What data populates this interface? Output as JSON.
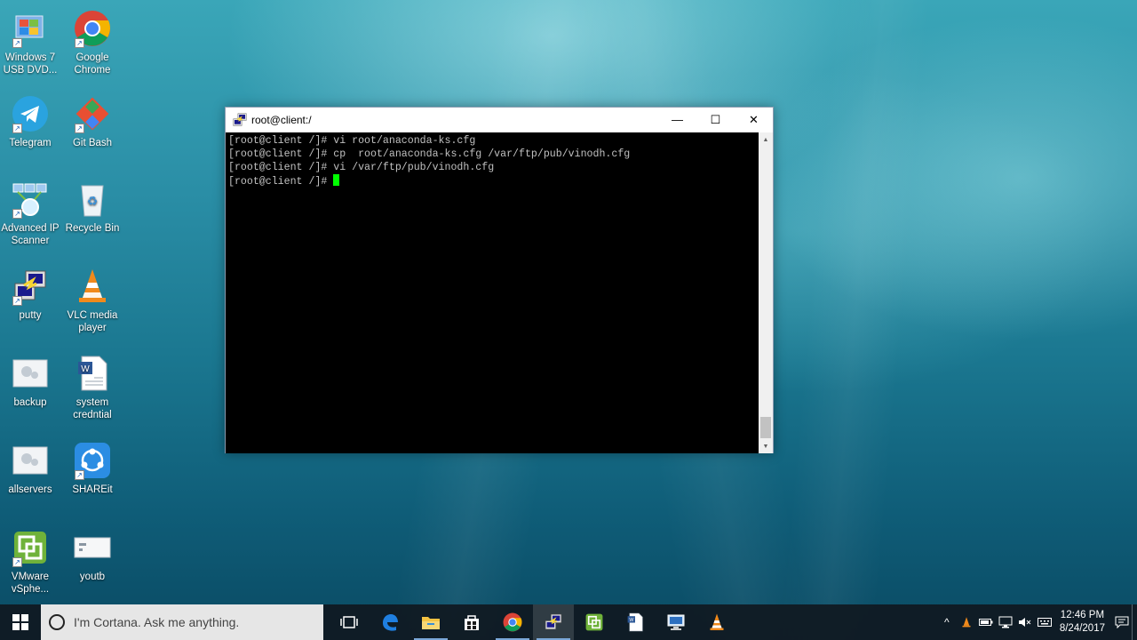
{
  "desktop": {
    "icons": [
      {
        "label": "Windows 7 USB DVD...",
        "icon": "usb-dvd-tool-icon"
      },
      {
        "label": "Google Chrome",
        "icon": "chrome-icon"
      },
      {
        "label": "Telegram",
        "icon": "telegram-icon"
      },
      {
        "label": "Git Bash",
        "icon": "git-bash-icon"
      },
      {
        "label": "Advanced IP Scanner",
        "icon": "ip-scanner-icon"
      },
      {
        "label": "Recycle Bin",
        "icon": "recycle-bin-icon"
      },
      {
        "label": "putty",
        "icon": "putty-icon"
      },
      {
        "label": "VLC media player",
        "icon": "vlc-icon"
      },
      {
        "label": "backup",
        "icon": "shortcut-file-icon"
      },
      {
        "label": "system credntial",
        "icon": "word-document-icon"
      },
      {
        "label": "allservers",
        "icon": "shortcut-file-icon"
      },
      {
        "label": "SHAREit",
        "icon": "shareit-icon"
      },
      {
        "label": "VMware vSphe...",
        "icon": "vmware-vsphere-icon"
      },
      {
        "label": "youtb",
        "icon": "text-file-icon"
      }
    ]
  },
  "window": {
    "title": "root@client:/",
    "minimize_glyph": "—",
    "maximize_glyph": "☐",
    "close_glyph": "✕",
    "terminal_lines": [
      "[root@client /]# vi root/anaconda-ks.cfg",
      "[root@client /]# cp  root/anaconda-ks.cfg /var/ftp/pub/vinodh.cfg",
      "[root@client /]# vi /var/ftp/pub/vinodh.cfg"
    ],
    "prompt": "[root@client /]# ",
    "cursor_color": "#00ff00",
    "background_color": "#000000"
  },
  "taskbar": {
    "search_placeholder": "I'm Cortana. Ask me anything.",
    "apps": [
      {
        "name": "task-view",
        "icon": "task-view-icon"
      },
      {
        "name": "edge",
        "icon": "edge-icon"
      },
      {
        "name": "file-explorer",
        "icon": "file-explorer-icon"
      },
      {
        "name": "store",
        "icon": "store-icon"
      },
      {
        "name": "chrome",
        "icon": "chrome-icon"
      },
      {
        "name": "putty",
        "icon": "putty-icon",
        "active": true
      },
      {
        "name": "vmware",
        "icon": "vmware-vsphere-icon"
      },
      {
        "name": "word",
        "icon": "word-icon"
      },
      {
        "name": "remote-desktop",
        "icon": "remote-desktop-icon"
      },
      {
        "name": "vlc",
        "icon": "vlc-icon"
      }
    ],
    "tray": {
      "time": "12:46 PM",
      "date": "8/24/2017"
    },
    "accent_color": "#7aa7d8"
  }
}
